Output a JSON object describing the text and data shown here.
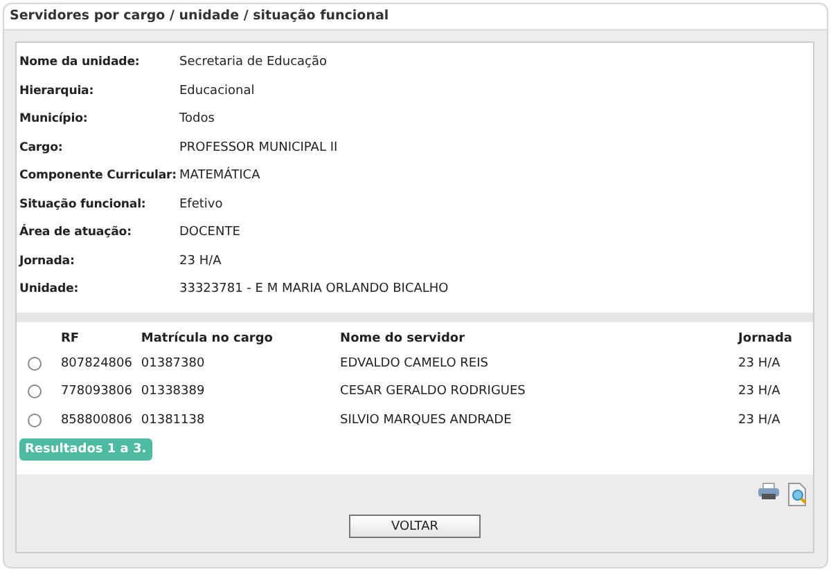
{
  "panel": {
    "title": "Servidores por cargo / unidade / situação funcional"
  },
  "details": [
    {
      "label": "Nome da unidade:",
      "value": "Secretaria de Educação"
    },
    {
      "label": "Hierarquia:",
      "value": "Educacional"
    },
    {
      "label": "Município:",
      "value": "Todos"
    },
    {
      "label": "Cargo:",
      "value": "PROFESSOR MUNICIPAL II"
    },
    {
      "label": "Componente Curricular:",
      "value": "MATEMÁTICA"
    },
    {
      "label": "Situação funcional:",
      "value": "Efetivo"
    },
    {
      "label": "Área de atuação:",
      "value": "DOCENTE"
    },
    {
      "label": "Jornada:",
      "value": "23 H/A"
    },
    {
      "label": "Unidade:",
      "value": "33323781 - E M MARIA ORLANDO BICALHO"
    }
  ],
  "table": {
    "columns": [
      "RF",
      "Matrícula no cargo",
      "Nome do servidor",
      "Jornada"
    ],
    "rows": [
      {
        "selected": false,
        "cells": [
          "807824806",
          "01387380",
          "EDVALDO CAMELO REIS",
          "23 H/A"
        ]
      },
      {
        "selected": false,
        "cells": [
          "778093806",
          "01338389",
          "CESAR GERALDO RODRIGUES",
          "23 H/A"
        ]
      },
      {
        "selected": false,
        "cells": [
          "858800806",
          "01381138",
          "SILVIO MARQUES ANDRADE",
          "23 H/A"
        ]
      }
    ]
  },
  "results_badge": "Resultados 1 a 3.",
  "button": "VOLTAR"
}
